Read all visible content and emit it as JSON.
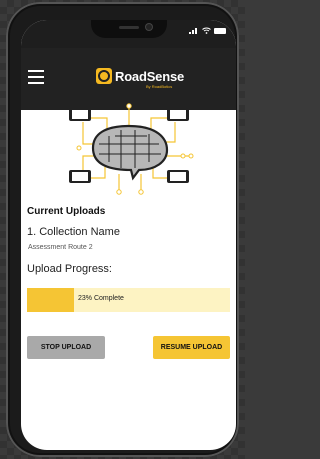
{
  "app": {
    "brand_name": "RoadSense",
    "brand_sub": "By RoadBotics"
  },
  "status_bar": {
    "signal": "▐",
    "wifi": "▿"
  },
  "uploads": {
    "section_title": "Current Uploads",
    "collection_name": "1. Collection Name",
    "route_name": "Assessment Route 2",
    "progress_label": "Upload Progress:",
    "progress_percent": 23,
    "progress_text": "23% Complete"
  },
  "buttons": {
    "stop": "STOP UPLOAD",
    "resume": "RESUME UPLOAD"
  },
  "colors": {
    "accent": "#f5c534",
    "topbar": "#222222",
    "stop": "#a9a9a9"
  }
}
